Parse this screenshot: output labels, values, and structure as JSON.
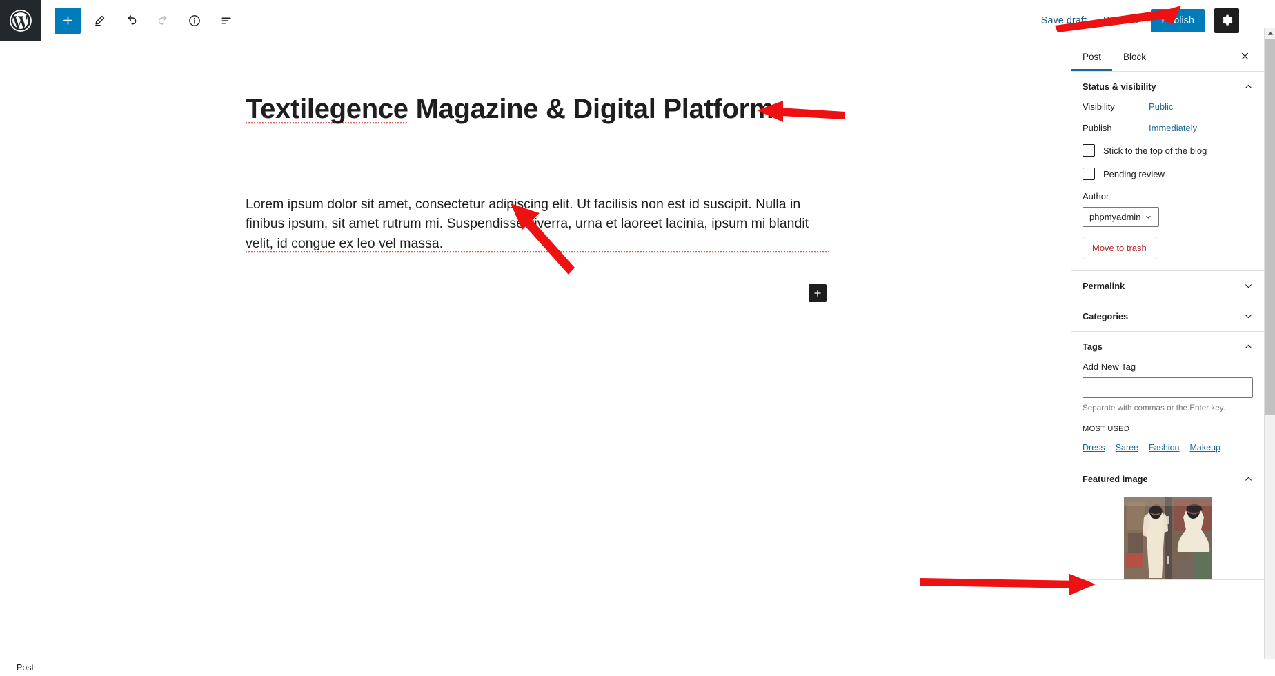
{
  "topbar": {
    "logo_icon": "wordpress-logo-icon",
    "tools": [
      {
        "name": "block-inserter-button",
        "icon": "plus-icon",
        "state": "active"
      },
      {
        "name": "tools-edit-button",
        "icon": "pencil-icon",
        "state": "default"
      },
      {
        "name": "undo-button",
        "icon": "undo-arrow-icon",
        "state": "default"
      },
      {
        "name": "redo-button",
        "icon": "redo-arrow-icon",
        "state": "disabled"
      },
      {
        "name": "details-button",
        "icon": "info-circle-icon",
        "state": "default"
      },
      {
        "name": "list-view-button",
        "icon": "list-view-icon",
        "state": "default"
      }
    ],
    "save_draft_label": "Save draft",
    "preview_label": "Preview",
    "publish_label": "Publish",
    "settings_icon": "gear-icon",
    "more_options_icon": "kebab-menu-icon",
    "accent_color": "#007cba"
  },
  "editor": {
    "title": "Textilegence Magazine & Digital Platform",
    "title_misspelled_word": "Textilegence",
    "paragraph": "Lorem ipsum dolor sit amet, consectetur adipiscing elit. Ut facilisis non est id suscipit. Nulla in finibus ipsum, sit amet rutrum mi. Suspendisse viverra, urna et laoreet lacinia, ipsum mi blandit velit, id congue ex leo vel massa.",
    "inserter_icon": "plus-icon"
  },
  "sidebar": {
    "tabs": [
      {
        "label": "Post",
        "active": true
      },
      {
        "label": "Block",
        "active": false
      }
    ],
    "close_icon": "close-icon",
    "panels": [
      {
        "title": "Status & visibility",
        "expanded": true
      },
      {
        "title": "Permalink",
        "expanded": false
      },
      {
        "title": "Categories",
        "expanded": false
      },
      {
        "title": "Tags",
        "expanded": true
      },
      {
        "title": "Featured image",
        "expanded": true
      }
    ],
    "status_visibility": {
      "visibility_label": "Visibility",
      "visibility_value": "Public",
      "publish_label": "Publish",
      "publish_value": "Immediately",
      "sticky_label": "Stick to the top of the blog",
      "sticky_checked": false,
      "pending_label": "Pending review",
      "pending_checked": false,
      "author_label": "Author",
      "author_value": "phpmyadmin",
      "trash_label": "Move to trash",
      "trash_color": "#b3262a",
      "link_color": "#1a6a94"
    },
    "tags": {
      "add_label": "Add New Tag",
      "input_value": "",
      "input_placeholder": "",
      "help_text": "Separate with commas or the Enter key.",
      "most_used_label": "MOST USED",
      "most_used": [
        "Dress",
        "Saree",
        "Fashion",
        "Makeup"
      ]
    },
    "featured_image": {
      "alt": "Two ivory wedding dresses on black mannequins in a shop window"
    }
  },
  "statusbar": {
    "text": "Post"
  },
  "scrollbar": {
    "up_icon": "scroll-up-arrow-icon",
    "down_icon": "scroll-down-arrow-icon"
  },
  "annotations": {
    "color": "#ee1111",
    "arrows": [
      {
        "name": "arrow-to-publish-button",
        "target": "publish-button"
      },
      {
        "name": "arrow-to-post-title",
        "target": "post-title"
      },
      {
        "name": "arrow-to-paragraph",
        "target": "post-paragraph"
      },
      {
        "name": "arrow-to-featured-image",
        "target": "featured-image"
      }
    ]
  }
}
